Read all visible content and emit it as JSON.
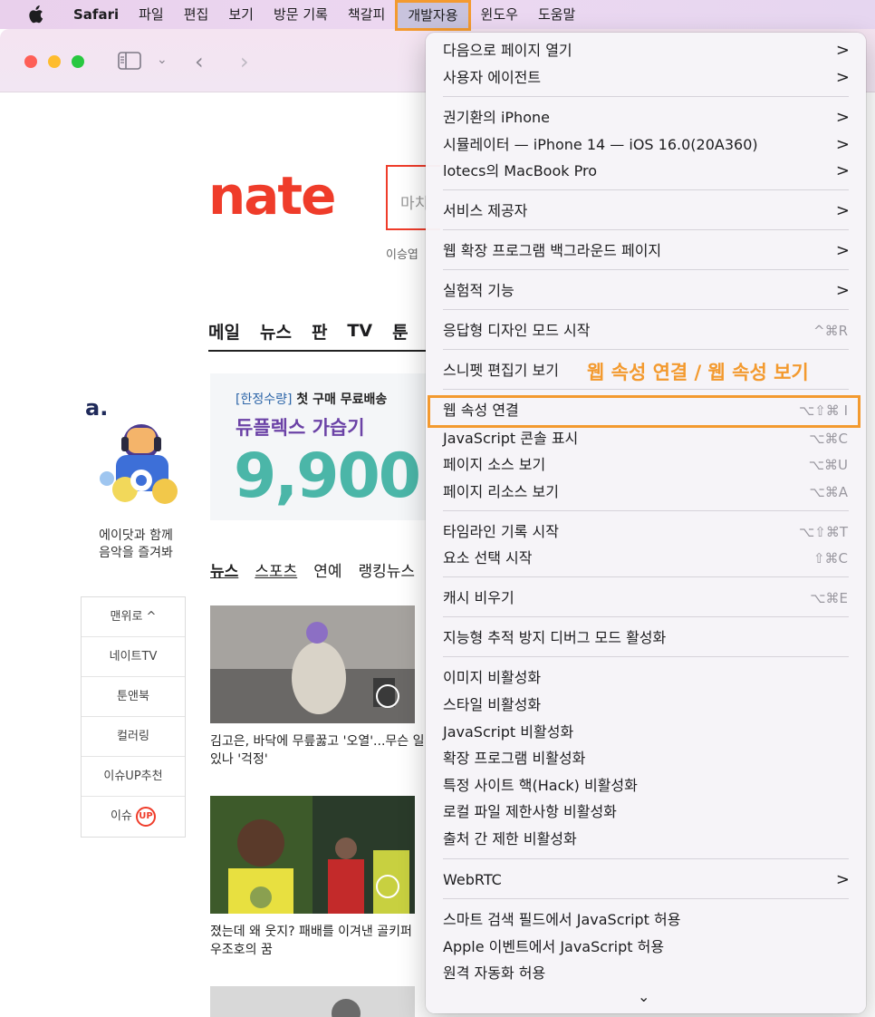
{
  "menubar": {
    "app_name": "Safari",
    "items": [
      "파일",
      "편집",
      "보기",
      "방문 기록",
      "책갈피",
      "개발자용",
      "윈도우",
      "도움말"
    ]
  },
  "page": {
    "logo": "nate",
    "search_placeholder": "마치",
    "user_line": "이승엽",
    "nav": [
      "메일",
      "뉴스",
      "판",
      "TV",
      "툰"
    ],
    "banner": {
      "line1_tag": "[한정수량]",
      "line1_text": " 첫 구매 무료배송",
      "line2": "듀플렉스 가습기",
      "price": "9,900"
    },
    "side_promo": "에이닷과 함께\n음악을 즐겨봐",
    "side_nav": [
      "맨위로 ^",
      "네이트TV",
      "툰앤북",
      "컬러링",
      "이슈UP추천",
      "이슈"
    ],
    "side_nav_badge": "UP",
    "news_tabs": [
      "뉴스",
      "스포츠",
      "연예",
      "랭킹뉴스"
    ],
    "news": [
      {
        "caption": "김고은, 바닥에 무릎꿇고 '오열'...무슨 일 있나 '걱정'"
      },
      {
        "caption": "졌는데 왜 웃지? 패배를 이겨낸 골키퍼 우조호의 꿈"
      }
    ]
  },
  "develop_menu": {
    "items": [
      {
        "label": "다음으로 페이지 열기",
        "submenu": true
      },
      {
        "label": "사용자 에이전트",
        "submenu": true
      },
      {
        "label": "권기환의 iPhone",
        "submenu": true
      },
      {
        "label": "시뮬레이터 — iPhone 14 — iOS 16.0(20A360)",
        "submenu": true
      },
      {
        "label": "lotecs의 MacBook Pro",
        "submenu": true
      },
      {
        "label": "서비스 제공자",
        "submenu": true
      },
      {
        "label": "웹 확장 프로그램 백그라운드 페이지",
        "submenu": true
      },
      {
        "label": "실험적 기능",
        "submenu": true
      },
      {
        "label": "응답형 디자인 모드 시작",
        "shortcut": "^⌘R"
      },
      {
        "label": "스니펫 편집기 보기"
      },
      {
        "label": "웹 속성 연결",
        "shortcut": "⌥⇧⌘ I"
      },
      {
        "label": "JavaScript 콘솔 표시",
        "shortcut": "⌥⌘C"
      },
      {
        "label": "페이지 소스 보기",
        "shortcut": "⌥⌘U"
      },
      {
        "label": "페이지 리소스 보기",
        "shortcut": "⌥⌘A"
      },
      {
        "label": "타임라인 기록 시작",
        "shortcut": "⌥⇧⌘T"
      },
      {
        "label": "요소 선택 시작",
        "shortcut": "⇧⌘C"
      },
      {
        "label": "캐시 비우기",
        "shortcut": "⌥⌘E"
      },
      {
        "label": "지능형 추적 방지 디버그 모드 활성화"
      },
      {
        "label": "이미지 비활성화"
      },
      {
        "label": "스타일 비활성화"
      },
      {
        "label": "JavaScript 비활성화"
      },
      {
        "label": "확장 프로그램 비활성화"
      },
      {
        "label": "특정 사이트 핵(Hack) 비활성화"
      },
      {
        "label": "로컬 파일 제한사항 비활성화"
      },
      {
        "label": "출처 간 제한 비활성화"
      },
      {
        "label": "WebRTC",
        "submenu": true
      },
      {
        "label": "스마트 검색 필드에서 JavaScript 허용"
      },
      {
        "label": "Apple 이벤트에서 JavaScript 허용"
      },
      {
        "label": "원격 자동화 허용"
      }
    ],
    "arrow_glyph": ">",
    "more_glyph": "⌄"
  },
  "annotation": "웹 속성 연결 / 웹 속성 보기",
  "colors": {
    "accent_highlight": "#f39a2f",
    "nate_red": "#ef3c2a"
  }
}
